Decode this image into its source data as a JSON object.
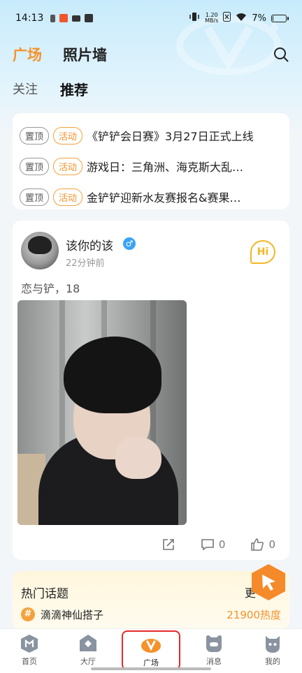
{
  "status_bar": {
    "time": "14:13",
    "speed_value": "1.20",
    "speed_unit": "MB/s",
    "battery": "7%",
    "battery_level": 0.07
  },
  "header": {
    "tabs": [
      "广场",
      "照片墙"
    ],
    "active_tab": 0
  },
  "subtabs": {
    "tabs": [
      "关注",
      "推荐"
    ],
    "active_tab": 1
  },
  "pinned": [
    {
      "tag_top": "置顶",
      "tag_activity": "活动",
      "text": "《铲铲会日赛》3月27日正式上线"
    },
    {
      "tag_top": "置顶",
      "tag_activity": "活动",
      "text": "游戏日：三角洲、海克斯大乱…"
    },
    {
      "tag_top": "置顶",
      "tag_activity": "活动",
      "text": "金铲铲迎新水友赛报名&赛果…"
    }
  ],
  "post": {
    "username": "该你的该",
    "gender_symbol": "♂",
    "time": "22分钟前",
    "hi_label": "Hi",
    "text": "恋与铲，18",
    "comments": "0",
    "likes": "0"
  },
  "hot": {
    "title": "热门话题",
    "more": "更",
    "hash": "#",
    "topic": "滴滴神仙搭子",
    "heat": "21900热度"
  },
  "nav": [
    {
      "label": "首页",
      "icon": "home-icon"
    },
    {
      "label": "大厅",
      "icon": "lobby-icon"
    },
    {
      "label": "广场",
      "icon": "plaza-icon"
    },
    {
      "label": "消息",
      "icon": "message-icon"
    },
    {
      "label": "我的",
      "icon": "profile-icon"
    }
  ],
  "nav_active": 2,
  "colors": {
    "accent": "#f5922b",
    "highlight_outline": "#e52a2a",
    "gender": "#3aa3f5"
  }
}
